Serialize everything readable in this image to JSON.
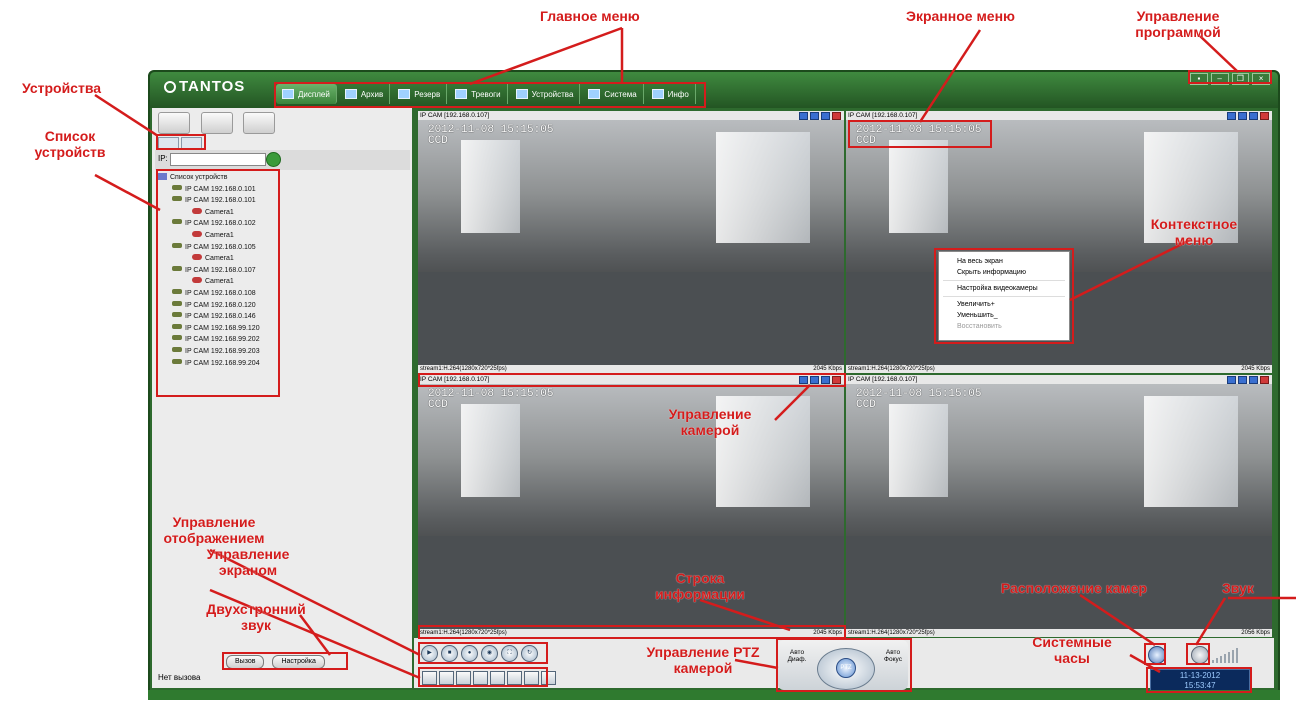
{
  "app": {
    "logo": "TANTOS",
    "menu": [
      {
        "label": "Дисплей",
        "active": true
      },
      {
        "label": "Архив",
        "active": false
      },
      {
        "label": "Резерв",
        "active": false
      },
      {
        "label": "Тревоги",
        "active": false
      },
      {
        "label": "Устройства",
        "active": false
      },
      {
        "label": "Система",
        "active": false
      },
      {
        "label": "Инфо",
        "active": false
      }
    ]
  },
  "left_panel": {
    "ip_label": "IP:",
    "ip_value": "",
    "tree": {
      "root": "Список устройств",
      "items": [
        {
          "label": "IP CAM 192.168.0.101",
          "level": 1,
          "kind": "device"
        },
        {
          "label": "IP CAM 192.168.0.101",
          "level": 1,
          "kind": "device"
        },
        {
          "label": "Camera1",
          "level": 2,
          "kind": "camera"
        },
        {
          "label": "IP CAM 192.168.0.102",
          "level": 1,
          "kind": "device"
        },
        {
          "label": "Camera1",
          "level": 2,
          "kind": "camera"
        },
        {
          "label": "IP CAM 192.168.0.105",
          "level": 1,
          "kind": "device"
        },
        {
          "label": "Camera1",
          "level": 2,
          "kind": "camera"
        },
        {
          "label": "IP CAM 192.168.0.107",
          "level": 1,
          "kind": "device"
        },
        {
          "label": "Camera1",
          "level": 2,
          "kind": "camera"
        },
        {
          "label": "IP CAM 192.168.0.108",
          "level": 1,
          "kind": "device"
        },
        {
          "label": "IP CAM 192.168.0.120",
          "level": 1,
          "kind": "device"
        },
        {
          "label": "IP CAM 192.168.0.146",
          "level": 1,
          "kind": "device"
        },
        {
          "label": "IP CAM 192.168.99.120",
          "level": 1,
          "kind": "device"
        },
        {
          "label": "IP CAM 192.168.99.202",
          "level": 1,
          "kind": "device"
        },
        {
          "label": "IP CAM 192.168.99.203",
          "level": 1,
          "kind": "device"
        },
        {
          "label": "IP CAM 192.168.99.204",
          "level": 1,
          "kind": "device"
        }
      ]
    },
    "call_button": "Вызов",
    "settings_button": "Настройка",
    "call_status": "Нет вызова"
  },
  "video": {
    "cells": [
      {
        "title": "IP CAM [192.168.0.107]",
        "osd_time": "2012-11-08 15:15:05",
        "osd_name": "CCD",
        "stream": "stream1:H.264(1280x720*25fps)",
        "bitrate": "2045 Kbps"
      },
      {
        "title": "IP CAM [192.168.0.107]",
        "osd_time": "2012-11-08 15:15:05",
        "osd_name": "CCD",
        "stream": "stream1:H.264(1280x720*25fps)",
        "bitrate": "2045 Kbps"
      },
      {
        "title": "IP CAM [192.168.0.107]",
        "osd_time": "2012-11-08 15:15:05",
        "osd_name": "CCD",
        "stream": "stream1:H.264(1280x720*25fps)",
        "bitrate": "2045 Kbps"
      },
      {
        "title": "IP CAM [192.168.0.107]",
        "osd_time": "2012-11-08 15:15:05",
        "osd_name": "CCD",
        "stream": "stream1:H.264(1280x720*25fps)",
        "bitrate": "2056 Kbps"
      }
    ],
    "context_menu": [
      {
        "label": "На весь экран",
        "enabled": true
      },
      {
        "label": "Скрыть информацию",
        "enabled": true
      },
      {
        "label": "Настройка видеокамеры",
        "enabled": true
      },
      {
        "label": "Увеличить+",
        "enabled": true
      },
      {
        "label": "Уменьшить_",
        "enabled": true
      },
      {
        "label": "Восстановить",
        "enabled": false
      }
    ]
  },
  "ptz": {
    "auto_left": "Авто Диаф.",
    "auto_right": "Авто Фокус",
    "center": "PTZ"
  },
  "clock": {
    "date": "11-13-2012",
    "time": "15:53:47"
  },
  "annotations": {
    "main_menu": "Главное меню",
    "screen_menu": "Экранное меню",
    "program_control": "Управление программой",
    "devices": "Устройства",
    "device_list": "Список устройств",
    "context_menu": "Контекстное меню",
    "camera_control": "Управление камерой",
    "display_control": "Управление отображением",
    "screen_control": "Управление экраном",
    "two_way_audio": "Двухстронний звук",
    "info_line": "Строка информации",
    "ptz_control": "Управление PTZ камерой",
    "camera_layout": "Расположение камер",
    "sound": "Звук",
    "system_clock": "Системные часы"
  },
  "colors": {
    "frame_green": "#2e6a2e",
    "annotation_red": "#d41c1c",
    "clock_bg": "#0b2a5c"
  }
}
